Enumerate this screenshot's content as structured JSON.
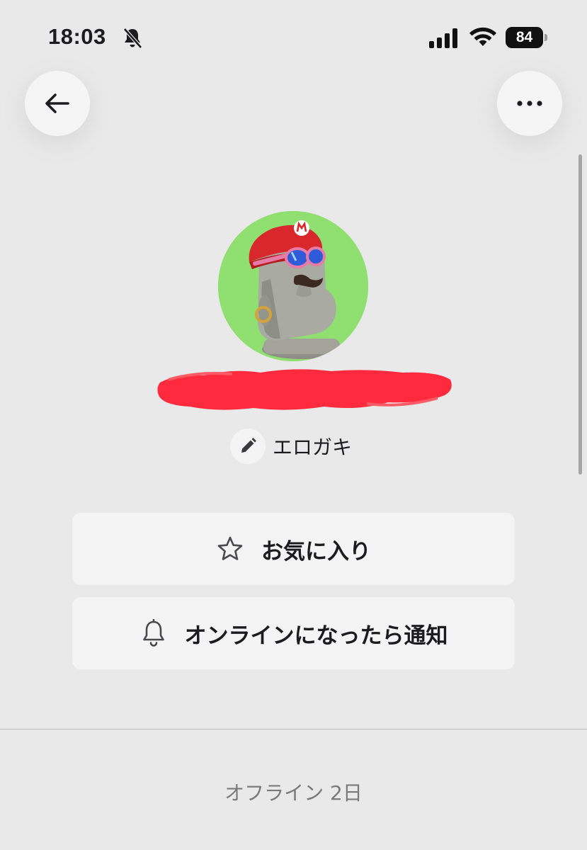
{
  "status_bar": {
    "time": "18:03",
    "battery_level": "84",
    "icons": [
      "bell-slash-icon",
      "cellular-signal-icon",
      "wifi-icon",
      "battery-icon"
    ]
  },
  "nav": {
    "back_icon": "arrow-left-icon",
    "more_icon": "ellipsis-icon"
  },
  "profile": {
    "avatar": "character-avatar-image",
    "avatar_bg": "#8fe070",
    "name_redaction_color": "#ff2a3d",
    "nickname": "エロガキ",
    "nickname_edit_icon": "pencil-icon"
  },
  "actions": {
    "favorite": {
      "icon": "star-outline-icon",
      "label": "お気に入り"
    },
    "notify": {
      "icon": "bell-outline-icon",
      "label": "オンラインになったら通知"
    }
  },
  "presence": {
    "offline_text": "オフライン 2日"
  },
  "colors": {
    "background": "#e9e9e9",
    "button_bg": "#f4f4f4",
    "text": "#1c1c1e",
    "muted_text": "#7a7a7a"
  }
}
